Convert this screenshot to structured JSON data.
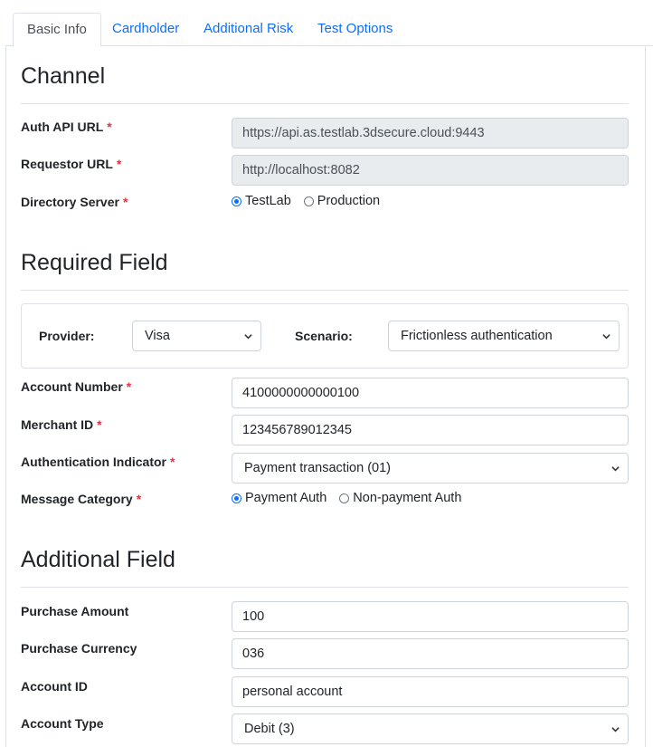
{
  "tabs": [
    {
      "label": "Basic Info"
    },
    {
      "label": "Cardholder"
    },
    {
      "label": "Additional Risk"
    },
    {
      "label": "Test Options"
    }
  ],
  "channel": {
    "title": "Channel",
    "auth_api_url": {
      "label": "Auth API URL",
      "value": "https://api.as.testlab.3dsecure.cloud:9443"
    },
    "requestor_url": {
      "label": "Requestor URL",
      "value": "http://localhost:8082"
    },
    "directory_server": {
      "label": "Directory Server",
      "options": [
        "TestLab",
        "Production"
      ],
      "selected": "TestLab"
    }
  },
  "required": {
    "title": "Required Field",
    "provider": {
      "label": "Provider:",
      "value": "Visa"
    },
    "scenario": {
      "label": "Scenario:",
      "value": "Frictionless authentication"
    },
    "account_number": {
      "label": "Account Number",
      "value": "4100000000000100"
    },
    "merchant_id": {
      "label": "Merchant ID",
      "value": "123456789012345"
    },
    "auth_indicator": {
      "label": "Authentication Indicator",
      "value": "Payment transaction (01)"
    },
    "message_category": {
      "label": "Message Category",
      "options": [
        "Payment Auth",
        "Non-payment Auth"
      ],
      "selected": "Payment Auth"
    }
  },
  "additional": {
    "title": "Additional Field",
    "purchase_amount": {
      "label": "Purchase Amount",
      "value": "100"
    },
    "purchase_currency": {
      "label": "Purchase Currency",
      "value": "036"
    },
    "account_id": {
      "label": "Account ID",
      "value": "personal account"
    },
    "account_type": {
      "label": "Account Type",
      "value": "Debit (3)"
    }
  },
  "required_marker": "*",
  "colors": {
    "accent": "#0d6efd",
    "required": "#dc3545"
  }
}
